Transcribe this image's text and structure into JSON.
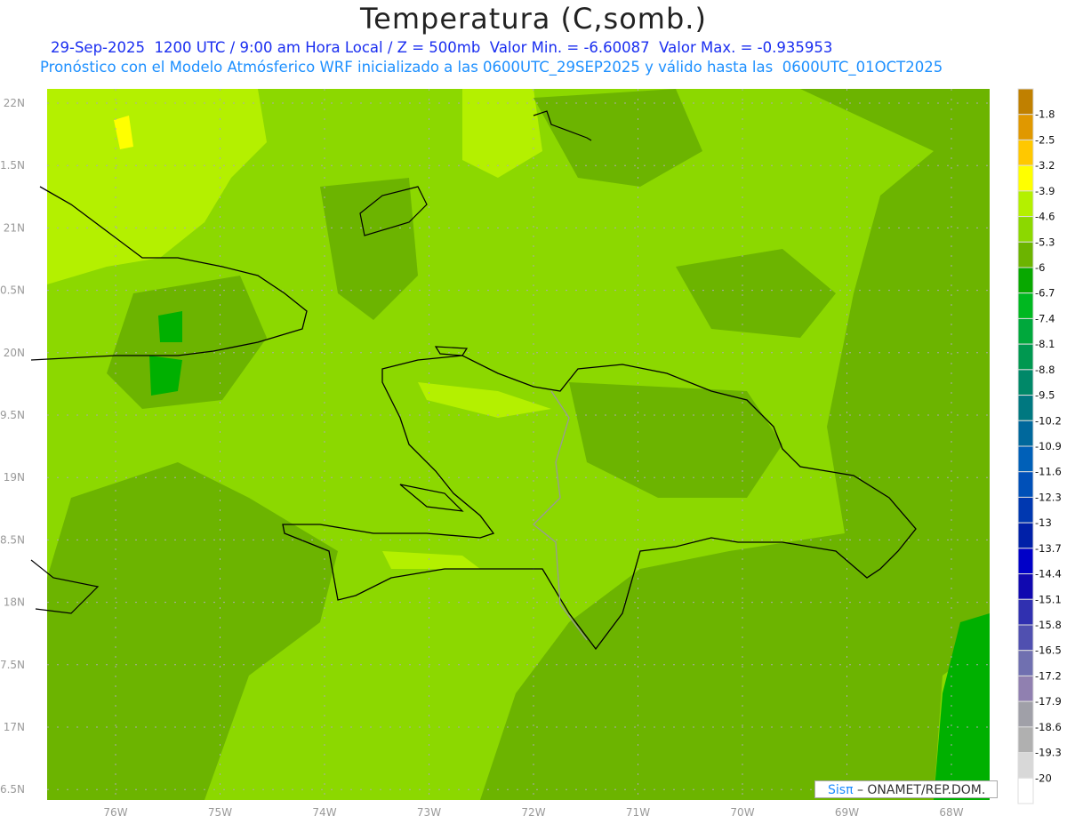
{
  "title": "Temperatura (C,somb.)",
  "subtitle1": "29-Sep-2025  1200 UTC / 9:00 am Hora Local / Z = 500mb  Valor Min. = -6.60087  Valor Max. = -0.935953",
  "subtitle2": "Pronóstico con el Modelo Atmósferico WRF inicializado a las 0600UTC_29SEP2025 y válido hasta las  0600UTC_01OCT2025",
  "lat_ticks": [
    {
      "lat": 22,
      "label": "22N"
    },
    {
      "lat": 21.5,
      "label": "1.5N"
    },
    {
      "lat": 21,
      "label": "21N"
    },
    {
      "lat": 20.5,
      "label": "0.5N"
    },
    {
      "lat": 20,
      "label": "20N"
    },
    {
      "lat": 19.5,
      "label": "9.5N"
    },
    {
      "lat": 19,
      "label": "19N"
    },
    {
      "lat": 18.5,
      "label": "8.5N"
    },
    {
      "lat": 18,
      "label": "18N"
    },
    {
      "lat": 17.5,
      "label": "7.5N"
    },
    {
      "lat": 17,
      "label": "17N"
    },
    {
      "lat": 16.5,
      "label": "6.5N"
    }
  ],
  "lon_ticks": [
    {
      "lon": -76,
      "label": "76W"
    },
    {
      "lon": -75,
      "label": "75W"
    },
    {
      "lon": -74,
      "label": "74W"
    },
    {
      "lon": -73,
      "label": "73W"
    },
    {
      "lon": -72,
      "label": "72W"
    },
    {
      "lon": -71,
      "label": "71W"
    },
    {
      "lon": -70,
      "label": "70W"
    },
    {
      "lon": -69,
      "label": "69W"
    },
    {
      "lon": -68,
      "label": "68W"
    }
  ],
  "colorbar": {
    "colors": [
      "#c08000",
      "#e09800",
      "#ffc800",
      "#ffff00",
      "#b4f000",
      "#8cd800",
      "#6cb400",
      "#08a800",
      "#00b820",
      "#00a83c",
      "#009850",
      "#008868",
      "#007880",
      "#00689c",
      "#0060b8",
      "#0050b8",
      "#0038b0",
      "#0020a8",
      "#0000c8",
      "#1008b0",
      "#3030b0",
      "#5050b0",
      "#7070b0",
      "#9080b0",
      "#a0a0a8",
      "#b0b0b0",
      "#d8d8d8",
      "#ffffff"
    ],
    "labels": [
      "-1.8",
      "-2.5",
      "-3.2",
      "-3.9",
      "-4.6",
      "-5.3",
      "-6",
      "-6.7",
      "-7.4",
      "-8.1",
      "-8.8",
      "-9.5",
      "-10.2",
      "-10.9",
      "-11.6",
      "-12.3",
      "-13",
      "-13.7",
      "-14.4",
      "-15.1",
      "-15.8",
      "-16.5",
      "-17.2",
      "-17.9",
      "-18.6",
      "-19.3",
      "-20"
    ]
  },
  "credit": {
    "brand": "Sisπ",
    "text": " –  ONAMET/REP.DOM."
  }
}
